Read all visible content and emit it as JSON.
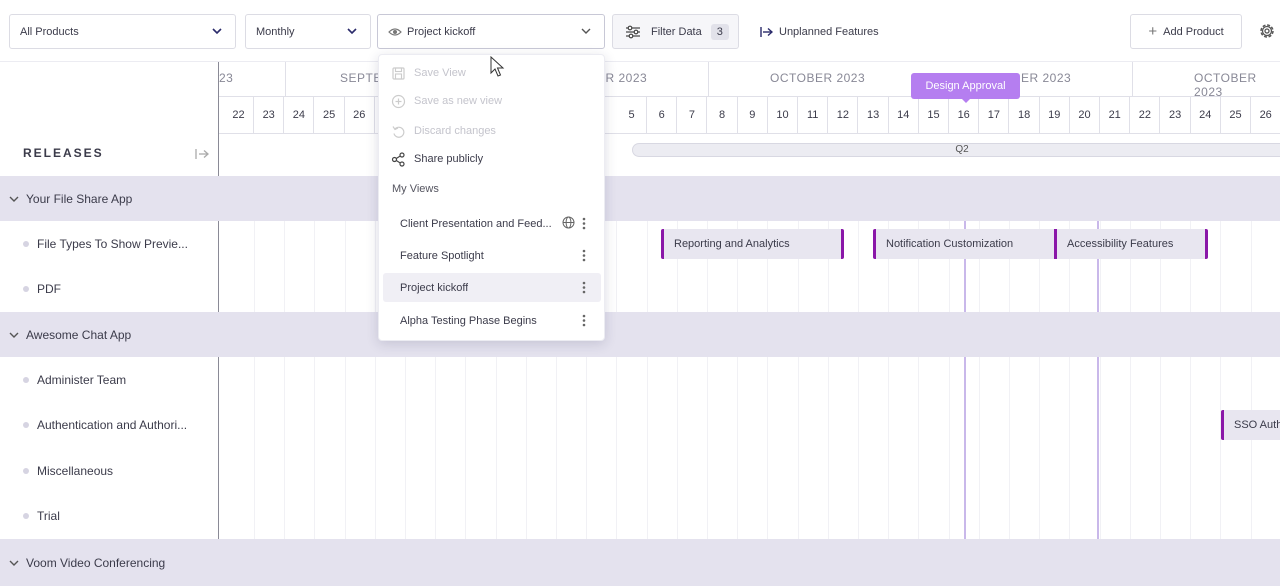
{
  "toolbar": {
    "product_select": "All Products",
    "period_select": "Monthly",
    "view_select": "Project kickoff",
    "filter_label": "Filter Data",
    "filter_count": "3",
    "unplanned_label": "Unplanned Features",
    "add_product_label": "Add Product"
  },
  "sidebar": {
    "releases_label": "RELEASES"
  },
  "timeline": {
    "months": [
      "23",
      "SEPTE",
      "ER 2023",
      "OCTOBER 2023",
      "ER 2023",
      "OCTOBER 2023"
    ],
    "days": [
      "22",
      "23",
      "24",
      "25",
      "26",
      "5",
      "6",
      "7",
      "8",
      "9",
      "10",
      "11",
      "12",
      "13",
      "14",
      "15",
      "16",
      "17",
      "18",
      "19",
      "20",
      "21",
      "22",
      "23",
      "24",
      "25",
      "26"
    ],
    "quarter_label": "Q2",
    "milestone_tooltip": "Design Approval"
  },
  "groups": [
    {
      "name": "Your File Share App",
      "items": [
        "File Types To Show Previe...",
        "PDF"
      ]
    },
    {
      "name": "Awesome Chat App",
      "items": [
        "Administer Team",
        "Authentication and Authori...",
        "Miscellaneous",
        "Trial"
      ]
    },
    {
      "name": "Voom Video Conferencing",
      "items": []
    }
  ],
  "bars": [
    {
      "label": "Reporting and Analytics"
    },
    {
      "label": "Notification Customization"
    },
    {
      "label": "Accessibility Features"
    },
    {
      "label": "SSO Auth"
    }
  ],
  "view_menu": {
    "save_view": "Save View",
    "save_as_new": "Save as new view",
    "discard": "Discard changes",
    "share": "Share publicly",
    "my_views_heading": "My Views",
    "views": [
      {
        "name": "Client Presentation and Feed...",
        "public": true
      },
      {
        "name": "Feature Spotlight",
        "public": false
      },
      {
        "name": "Project kickoff",
        "public": false,
        "active": true
      },
      {
        "name": "Alpha Testing Phase Begins",
        "public": false
      }
    ]
  },
  "colors": {
    "accent": "#8a17a8",
    "milestone": "#b57ef0",
    "group_bg": "#e4e2ee",
    "bar_bg": "#e8e6f0"
  }
}
